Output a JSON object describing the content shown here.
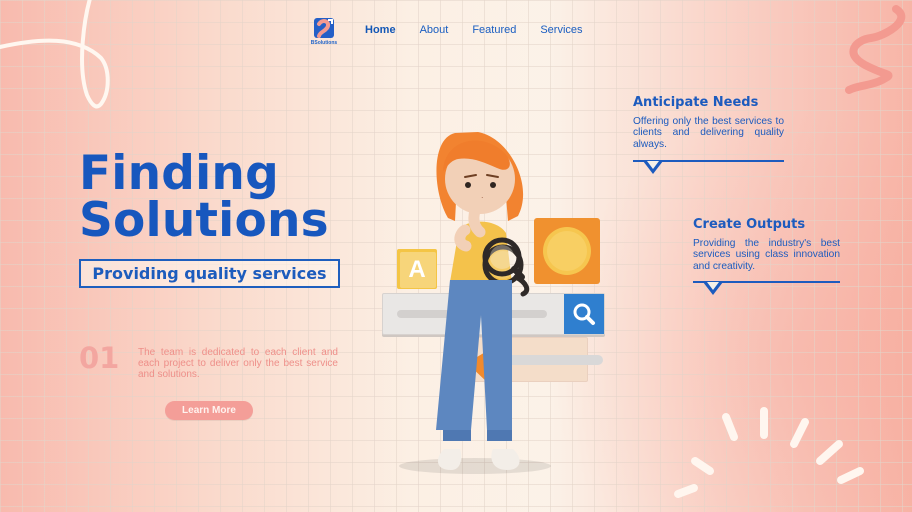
{
  "app": {
    "brand": "BSolutions"
  },
  "nav": {
    "items": [
      {
        "label": "Home",
        "active": true
      },
      {
        "label": "About",
        "active": false
      },
      {
        "label": "Featured",
        "active": false
      },
      {
        "label": "Services",
        "active": false
      }
    ]
  },
  "hero": {
    "title_line1": "Finding",
    "title_line2": "Solutions",
    "subtitle": "Providing quality services"
  },
  "step": {
    "number": "01",
    "text": "The team is dedicated to each client and each project to deliver only the best service and solutions."
  },
  "cta": {
    "learn_more": "Learn More"
  },
  "features": [
    {
      "title": "Anticipate Needs",
      "body": "Offering only the best services to clients and delivering quality always."
    },
    {
      "title": "Create Outputs",
      "body": "Providing the industry's best services using class innovation and creativity."
    }
  ],
  "illustration": {
    "letter_tile": "A"
  },
  "icons": {
    "logo": "brand-logo-icon",
    "search": "search-icon",
    "curve": "curve-decoration-icon",
    "squiggle": "squiggle-decoration-icon",
    "burst": "burst-decoration-icon",
    "play": "play-icon",
    "magnifier": "magnifier-icon",
    "speech_tail": "speech-tail-icon"
  },
  "colors": {
    "primary_blue": "#1d5bbe",
    "salmon": "#f49e98",
    "cream": "#fbf3e8",
    "orange": "#f39a2d",
    "yellow": "#f6c33c",
    "denim": "#5a86bf"
  }
}
